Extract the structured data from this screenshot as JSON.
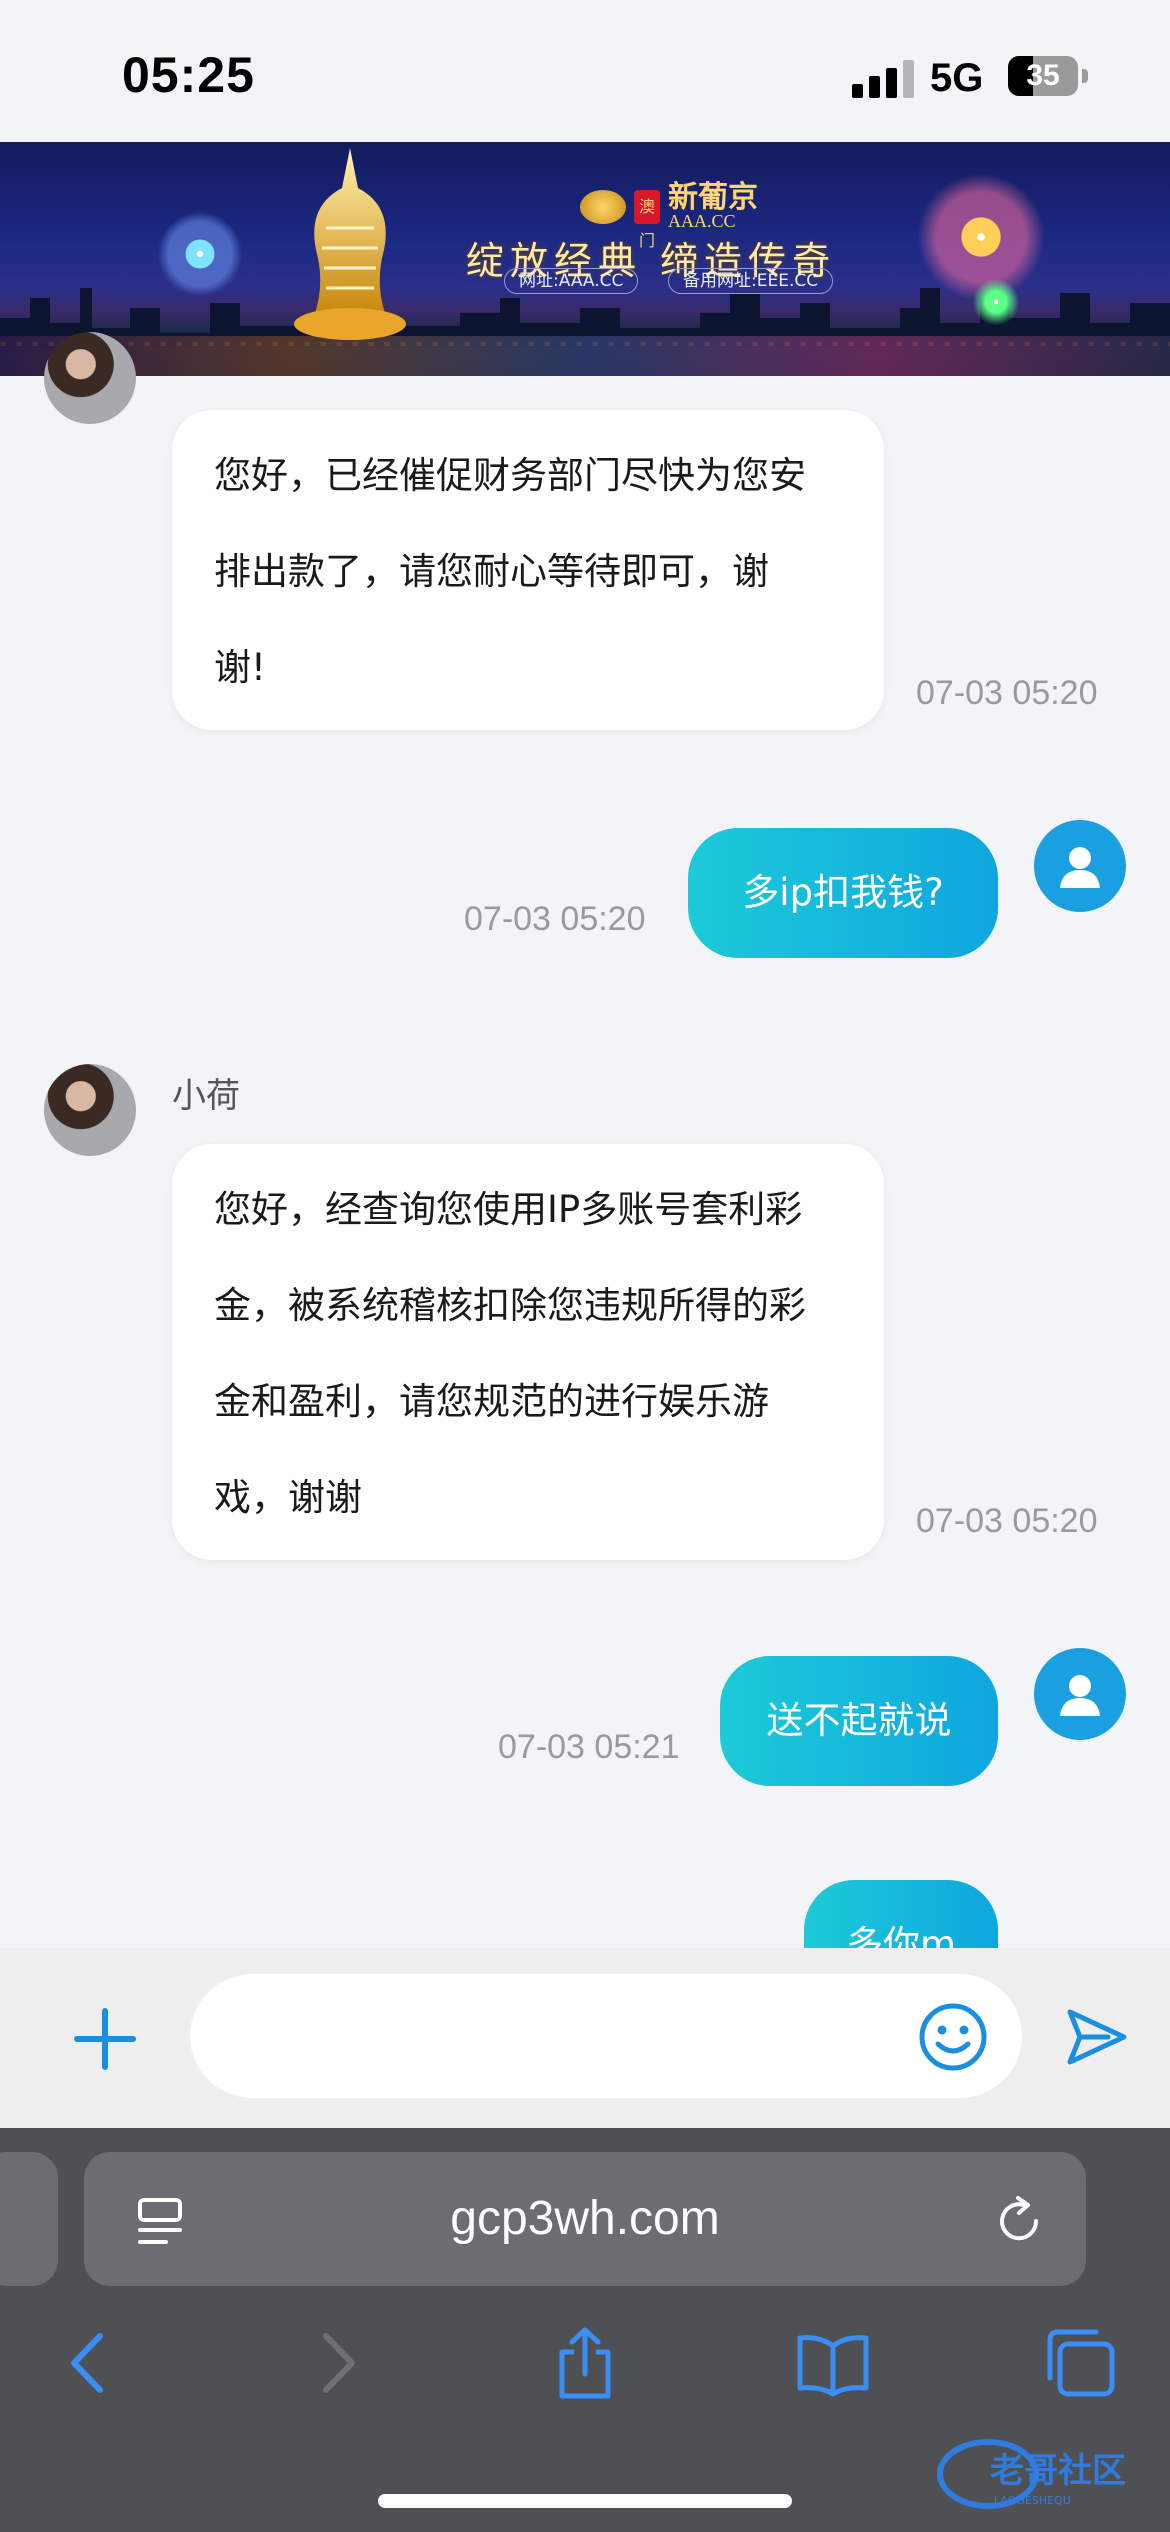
{
  "status_bar": {
    "time": "05:25",
    "network": "5G",
    "battery": "35",
    "battery_level": 0.35
  },
  "banner": {
    "brand_seal": "澳门",
    "brand_cn": "新葡京",
    "brand_en": "AAA.CC",
    "slogan": "绽放经典  缔造传奇",
    "url_main": "网址:AAA.CC",
    "url_backup": "备用网址:EEE.CC"
  },
  "chat": {
    "messages": [
      {
        "sender": "agent",
        "text_lines": [
          "您好，已经催促财务部门尽快为您安",
          "排出款了，请您耐心等待即可，谢",
          "谢!"
        ],
        "time": "07-03 05:20"
      },
      {
        "sender": "user",
        "text": "多ip扣我钱?",
        "time": "07-03 05:20"
      },
      {
        "sender": "agent",
        "name": "小荷",
        "text_lines": [
          "您好，经查询您使用IP多账号套利彩",
          "金，被系统稽核扣除您违规所得的彩",
          "金和盈利，请您规范的进行娱乐游",
          "戏，谢谢"
        ],
        "time": "07-03 05:20"
      },
      {
        "sender": "user",
        "text": "送不起就说",
        "time": "07-03 05:21"
      },
      {
        "sender": "user",
        "text": "多你m",
        "time": ""
      }
    ]
  },
  "input": {
    "placeholder": "",
    "value": ""
  },
  "browser": {
    "url": "gcp3wh.com"
  },
  "watermark": {
    "text": "老哥社区",
    "subtext": "LAOGESHEQU"
  },
  "colors": {
    "accent": "#1a8fe0",
    "user_bubble_start": "#1ccad8",
    "user_bubble_end": "#0fa6df",
    "safari_icon": "#3a8ef6"
  },
  "icons": [
    "signal-icon",
    "battery-icon",
    "plus-icon",
    "emoji-icon",
    "send-icon",
    "reader-icon",
    "reload-icon",
    "back-icon",
    "forward-icon",
    "share-icon",
    "bookmarks-icon",
    "tabs-icon"
  ]
}
